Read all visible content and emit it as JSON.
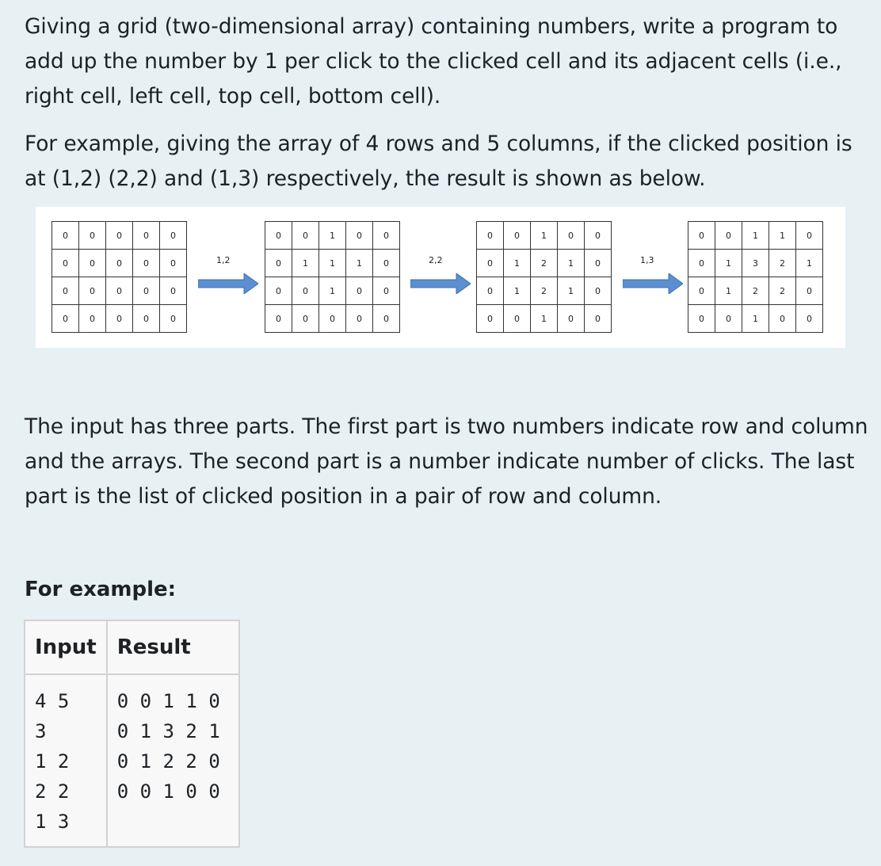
{
  "paragraphs": {
    "p1": "Giving a grid (two-dimensional array) containing numbers, write a program to add up the number by 1 per click to the clicked cell and its adjacent cells (i.e., right cell, left cell, top cell, bottom cell).",
    "p2": "For example, giving the array of 4 rows and 5 columns, if the clicked position is at (1,2) (2,2) and (1,3) respectively, the result is shown as below.",
    "p3": "The input has three parts. The first part is two numbers indicate row and column and the arrays. The second part is a number indicate number of clicks. The last part is the list of clicked position in a pair of row and column."
  },
  "figure": {
    "grids": [
      [
        [
          "0",
          "0",
          "0",
          "0",
          "0"
        ],
        [
          "0",
          "0",
          "0",
          "0",
          "0"
        ],
        [
          "0",
          "0",
          "0",
          "0",
          "0"
        ],
        [
          "0",
          "0",
          "0",
          "0",
          "0"
        ]
      ],
      [
        [
          "0",
          "0",
          "1",
          "0",
          "0"
        ],
        [
          "0",
          "1",
          "1",
          "1",
          "0"
        ],
        [
          "0",
          "0",
          "1",
          "0",
          "0"
        ],
        [
          "0",
          "0",
          "0",
          "0",
          "0"
        ]
      ],
      [
        [
          "0",
          "0",
          "1",
          "0",
          "0"
        ],
        [
          "0",
          "1",
          "2",
          "1",
          "0"
        ],
        [
          "0",
          "1",
          "2",
          "1",
          "0"
        ],
        [
          "0",
          "0",
          "1",
          "0",
          "0"
        ]
      ],
      [
        [
          "0",
          "0",
          "1",
          "1",
          "0"
        ],
        [
          "0",
          "1",
          "3",
          "2",
          "1"
        ],
        [
          "0",
          "1",
          "2",
          "2",
          "0"
        ],
        [
          "0",
          "0",
          "1",
          "0",
          "0"
        ]
      ]
    ],
    "arrow_labels": [
      "1,2",
      "2,2",
      "1,3"
    ],
    "arrow_color": "#5b8fd0"
  },
  "example": {
    "heading": "For example:",
    "headers": {
      "input": "Input",
      "result": "Result"
    },
    "input": "4 5\n3\n1 2\n2 2\n1 3",
    "result": "0 0 1 1 0\n0 1 3 2 1\n0 1 2 2 0\n0 0 1 0 0"
  }
}
